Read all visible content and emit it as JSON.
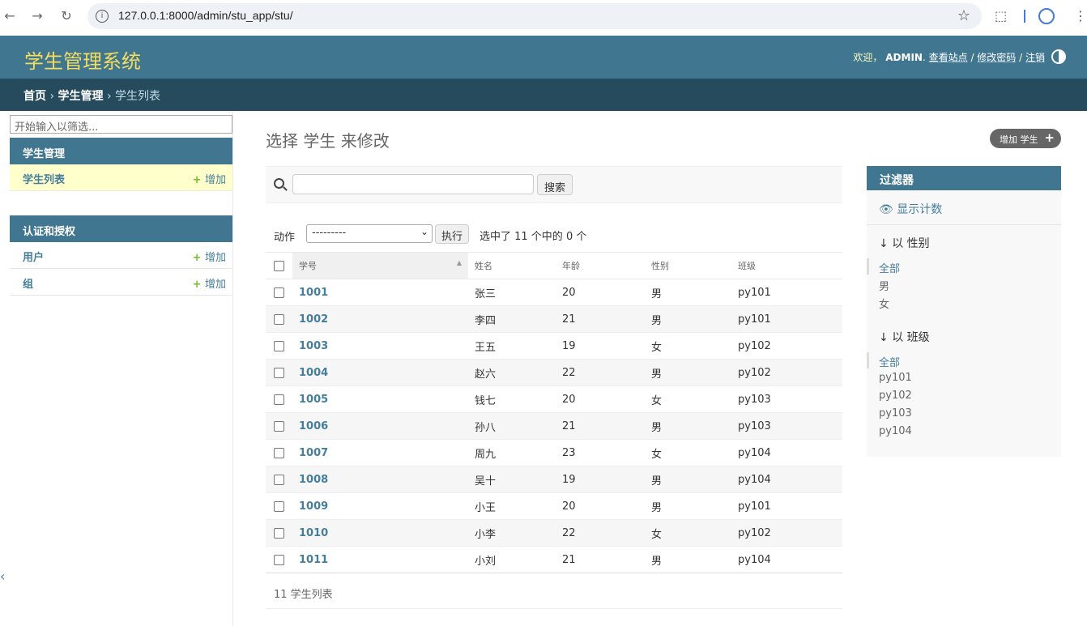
{
  "browser": {
    "url": "127.0.0.1:8000/admin/stu_app/stu/"
  },
  "header": {
    "site_title": "学生管理系统",
    "welcome": "欢迎，",
    "username": "ADMIN",
    "view_site": "查看站点",
    "change_password": "修改密码",
    "logout": "注销"
  },
  "breadcrumbs": {
    "home": "首页",
    "app": "学生管理",
    "current": "学生列表"
  },
  "sidebar": {
    "filter_placeholder": "开始输入以筛选...",
    "apps": [
      {
        "caption": "学生管理",
        "models": [
          {
            "name": "学生列表",
            "add": "增加"
          }
        ]
      },
      {
        "caption": "认证和授权",
        "models": [
          {
            "name": "用户",
            "add": "增加"
          },
          {
            "name": "组",
            "add": "增加"
          }
        ]
      }
    ]
  },
  "main": {
    "title": "选择 学生 来修改",
    "add_button": "增加 学生",
    "search_button": "搜索",
    "action_label": "动作",
    "action_select": "---------",
    "go_button": "执行",
    "selection_count": "选中了 11 个中的 0 个",
    "columns": [
      "学号",
      "姓名",
      "年龄",
      "性别",
      "班级"
    ],
    "rows": [
      [
        "1001",
        "张三",
        "20",
        "男",
        "py101"
      ],
      [
        "1002",
        "李四",
        "21",
        "男",
        "py101"
      ],
      [
        "1003",
        "王五",
        "19",
        "女",
        "py102"
      ],
      [
        "1004",
        "赵六",
        "22",
        "男",
        "py102"
      ],
      [
        "1005",
        "钱七",
        "20",
        "女",
        "py103"
      ],
      [
        "1006",
        "孙八",
        "21",
        "男",
        "py103"
      ],
      [
        "1007",
        "周九",
        "23",
        "女",
        "py104"
      ],
      [
        "1008",
        "吴十",
        "19",
        "男",
        "py104"
      ],
      [
        "1009",
        "小王",
        "20",
        "男",
        "py101"
      ],
      [
        "1010",
        "小李",
        "22",
        "女",
        "py102"
      ],
      [
        "1011",
        "小刘",
        "21",
        "男",
        "py104"
      ]
    ],
    "paginator": "11 学生列表"
  },
  "filter": {
    "title": "过滤器",
    "show_counts": "显示计数",
    "by_gender": "以 性别",
    "gender_options": [
      "全部",
      "男",
      "女"
    ],
    "by_class": "以 班级",
    "class_options": [
      "全部",
      "py101",
      "py102",
      "py103",
      "py104"
    ]
  }
}
